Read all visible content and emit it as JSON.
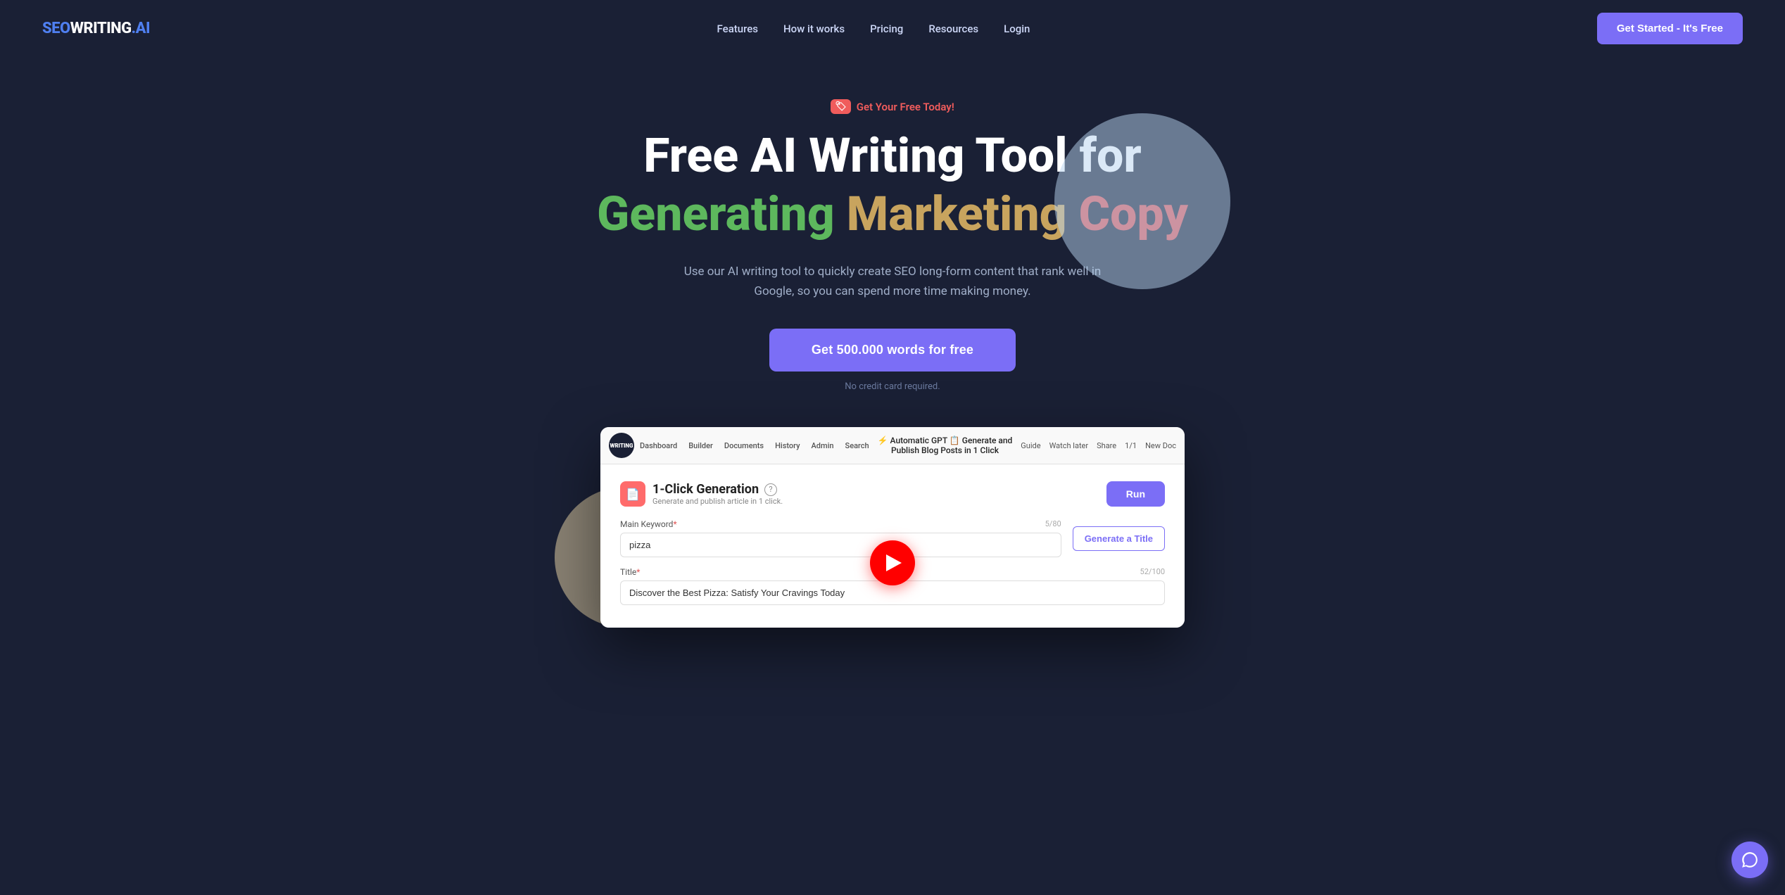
{
  "nav": {
    "logo": {
      "seo": "SEO",
      "writing": "WRITING",
      "dot": ".",
      "ai": "AI"
    },
    "links": [
      {
        "label": "Features",
        "id": "features"
      },
      {
        "label": "How it works",
        "id": "how-it-works"
      },
      {
        "label": "Pricing",
        "id": "pricing"
      },
      {
        "label": "Resources",
        "id": "resources"
      },
      {
        "label": "Login",
        "id": "login"
      }
    ],
    "cta_label": "Get Started - It's Free"
  },
  "hero": {
    "badge_icon": "🏷",
    "badge_text": "Get Your Free Today!",
    "title_line1": "Free AI Writing Tool for",
    "title_word1": "Generating",
    "title_word2": "Marketing",
    "title_word3": "Copy",
    "subtitle": "Use our AI writing tool to quickly create SEO long-form content that rank well in Google, so you can spend more time making money.",
    "cta_label": "Get 500.000 words for free",
    "no_cc_text": "No credit card required.",
    "help_icon": "?"
  },
  "video_bar": {
    "logo_text": "WRITING",
    "nav_items": [
      "Dashboard",
      "Builder",
      "Documents",
      "History",
      "Admin",
      "Search"
    ],
    "title": "⚡ Automatic GPT 📋 Generate and Publish Blog Posts in 1 Click",
    "watch_later": "Watch later",
    "share": "Share",
    "pagination": "1/1",
    "guide_label": "Guide",
    "new_doc_label": "New Doc"
  },
  "app": {
    "section_icon": "📄",
    "section_title": "1-Click Generation",
    "section_subtitle": "Generate and publish article in 1 click.",
    "help_icon": "?",
    "run_label": "Run",
    "keyword_label": "Main Keyword",
    "keyword_required": "*",
    "keyword_count": "5/80",
    "keyword_value": "pizza",
    "generate_title_label": "Generate a Title",
    "title_label": "Title",
    "title_required": "*",
    "title_count": "52/100",
    "title_value": "Discover the Best Pizza: Satisfy Your Cravings Today"
  }
}
